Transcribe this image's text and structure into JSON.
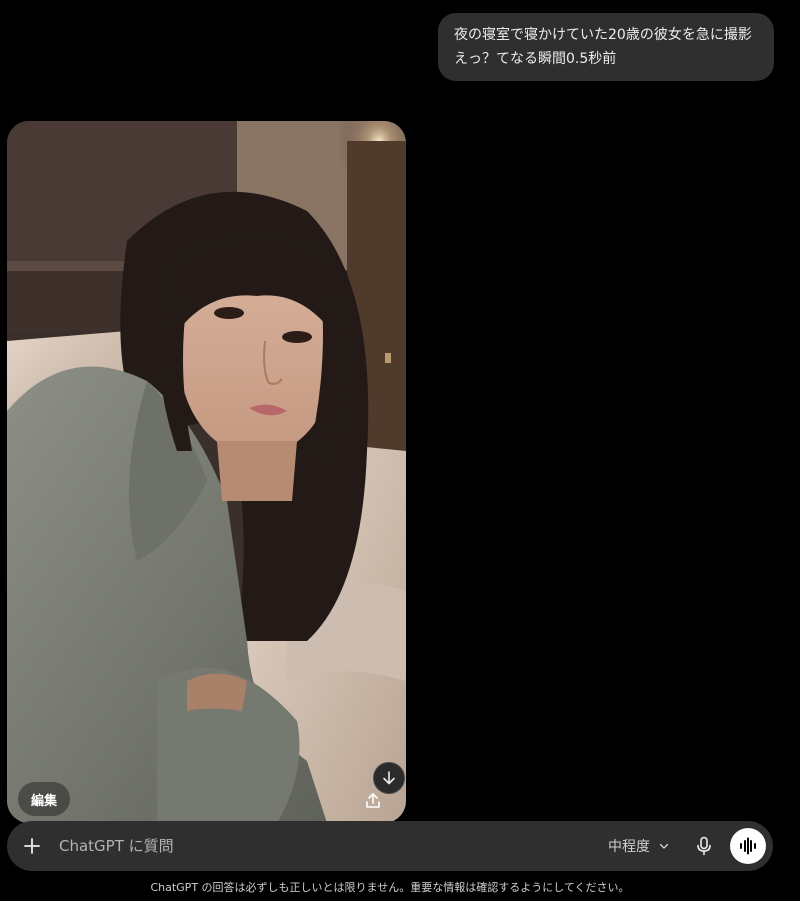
{
  "user_message": {
    "lines": [
      "夜の寝室で寝かけていた20歳の彼女を急に撮影",
      "えっ？てなる瞬間0.5秒前"
    ]
  },
  "image_actions": {
    "edit_label": "編集",
    "share_icon": "share-icon",
    "scroll_down_icon": "arrow-down-icon"
  },
  "composer": {
    "placeholder": "ChatGPT に質問",
    "value": "",
    "model_label": "中程度",
    "plus_icon": "plus-icon",
    "mic_icon": "microphone-icon",
    "voice_icon": "voice-mode-icon"
  },
  "disclaimer": "ChatGPT の回答は必ずしも正しいとは限りません。重要な情報は確認するようにしてください。",
  "colors": {
    "background": "#000000",
    "bubble": "#2f2f2f",
    "composer": "#2f2f2f",
    "text": "#ececec"
  }
}
